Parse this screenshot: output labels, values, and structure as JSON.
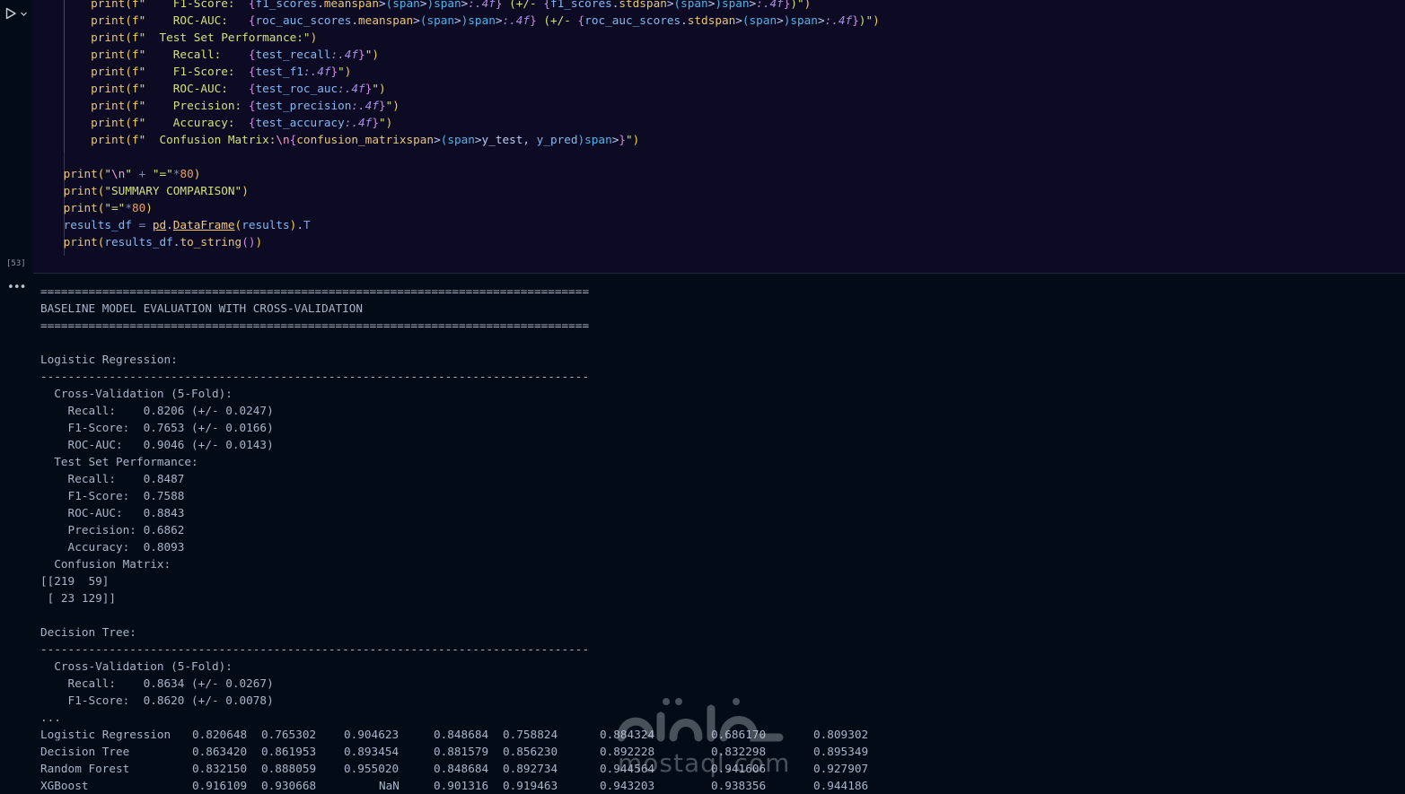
{
  "cell": {
    "execution_count": "[53]",
    "run_icon": "play-icon",
    "dropdown_icon": "chevron-down-icon"
  },
  "code_lines": [
    "        print(f\"    F1-Score:  {f1_scores.mean():.4f} (+/- {f1_scores.std():.4f})\")",
    "        print(f\"    ROC-AUC:   {roc_auc_scores.mean():.4f} (+/- {roc_auc_scores.std():.4f})\")",
    "        print(f\"  Test Set Performance:\")",
    "        print(f\"    Recall:    {test_recall:.4f}\")",
    "        print(f\"    F1-Score:  {test_f1:.4f}\")",
    "        print(f\"    ROC-AUC:   {test_roc_auc:.4f}\")",
    "        print(f\"    Precision: {test_precision:.4f}\")",
    "        print(f\"    Accuracy:  {test_accuracy:.4f}\")",
    "        print(f\"  Confusion Matrix:\\n{confusion_matrix(y_test, y_pred)}\")",
    "",
    "    print(\"\\n\" + \"=\"*80)",
    "    print(\"SUMMARY COMPARISON\")",
    "    print(\"=\"*80)",
    "    results_df = pd.DataFrame(results).T",
    "    print(results_df.to_string())"
  ],
  "output": {
    "more_icon": "ellipsis-icon",
    "lines": [
      "================================================================================",
      "BASELINE MODEL EVALUATION WITH CROSS-VALIDATION",
      "================================================================================",
      "",
      "Logistic Regression:",
      "--------------------------------------------------------------------------------",
      "  Cross-Validation (5-Fold):",
      "    Recall:    0.8206 (+/- 0.0247)",
      "    F1-Score:  0.7653 (+/- 0.0166)",
      "    ROC-AUC:   0.9046 (+/- 0.0143)",
      "  Test Set Performance:",
      "    Recall:    0.8487",
      "    F1-Score:  0.7588",
      "    ROC-AUC:   0.8843",
      "    Precision: 0.6862",
      "    Accuracy:  0.8093",
      "  Confusion Matrix:",
      "[[219  59]",
      " [ 23 129]]",
      "",
      "Decision Tree:",
      "--------------------------------------------------------------------------------",
      "  Cross-Validation (5-Fold):",
      "    Recall:    0.8634 (+/- 0.0267)",
      "    F1-Score:  0.8620 (+/- 0.0078)",
      "..."
    ],
    "table": [
      [
        "Logistic Regression",
        "0.820648",
        "0.765302",
        "0.904623",
        "0.848684",
        "0.758824",
        "0.884324",
        "0.686170",
        "0.809302"
      ],
      [
        "Decision Tree",
        "0.863420",
        "0.861953",
        "0.893454",
        "0.881579",
        "0.856230",
        "0.892228",
        "0.832298",
        "0.895349"
      ],
      [
        "Random Forest",
        "0.832150",
        "0.888059",
        "0.955020",
        "0.848684",
        "0.892734",
        "0.944564",
        "0.941606",
        "0.927907"
      ],
      [
        "XGBoost",
        "0.916109",
        "0.930668",
        "NaN",
        "0.901316",
        "0.919463",
        "0.943203",
        "0.938356",
        "0.944186"
      ]
    ]
  },
  "watermark": {
    "arabic": "مستقل",
    "latin": "mostaql.com"
  }
}
